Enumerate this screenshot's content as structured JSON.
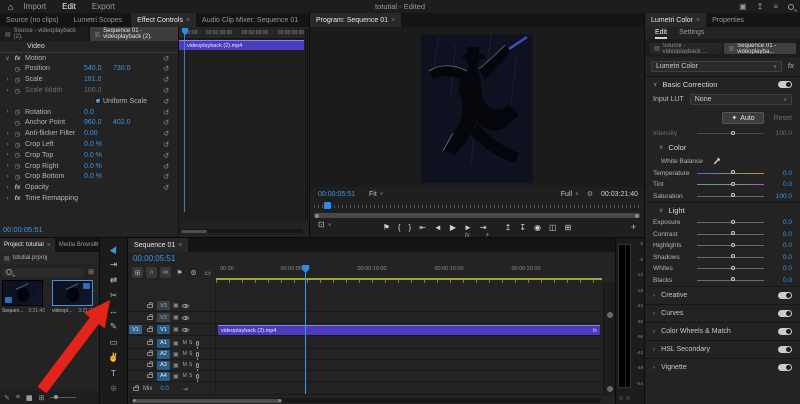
{
  "titlebar": {
    "home_icon": "⌂",
    "menus": [
      {
        "label": "Import"
      },
      {
        "label": "Edit",
        "cls": "active"
      },
      {
        "label": "Export"
      }
    ],
    "title": "totutial - Edited",
    "right_icons": [
      {
        "name": "workspace-icon",
        "glyph": "▣"
      },
      {
        "name": "export-icon",
        "glyph": "↥"
      },
      {
        "name": "stack-icon",
        "glyph": "≡"
      }
    ]
  },
  "effect_controls": {
    "tabs": [
      {
        "label": "Source (no clips)"
      },
      {
        "label": "Lumetri Scopes"
      },
      {
        "label": "Effect Controls",
        "cls": "active",
        "close": "×"
      },
      {
        "label": "Audio Clip Mixer: Sequence 01"
      }
    ],
    "clip_tabs": [
      {
        "icon": "▤",
        "label": "Source - videoplayback (2)."
      },
      {
        "icon": "▥",
        "label": "Sequence 01 - videoplayback (2).",
        "cls": "active"
      }
    ],
    "rows": [
      {
        "label": "Video",
        "cls": "hdr"
      },
      {
        "chev": "∨",
        "icon": "fx",
        "label": "Motion",
        "reset": "↺",
        "cls": "fxr"
      },
      {
        "icon": "◷",
        "label": "Position",
        "v1": "540.0",
        "v2": "730.0",
        "reset": "↺"
      },
      {
        "chev": "›",
        "icon": "◷",
        "label": "Scale",
        "v1": "181.0",
        "reset": "↺"
      },
      {
        "chev": "›",
        "icon": "◷",
        "label": "Scale Width",
        "v1": "100.0",
        "reset": "↺",
        "cls": "dim"
      },
      {
        "label": "Uniform Scale",
        "cls": "chk",
        "reset": "↺"
      },
      {
        "chev": "›",
        "icon": "◷",
        "label": "Rotation",
        "v1": "0.0",
        "reset": "↺"
      },
      {
        "icon": "◷",
        "label": "Anchor Point",
        "v1": "960.0",
        "v2": "402.0",
        "reset": "↺"
      },
      {
        "chev": "›",
        "icon": "◷",
        "label": "Anti-flicker Filter",
        "v1": "0.00",
        "reset": "↺"
      },
      {
        "chev": "›",
        "icon": "◷",
        "label": "Crop Left",
        "v1": "0.0 %",
        "reset": "↺"
      },
      {
        "chev": "›",
        "icon": "◷",
        "label": "Crop Top",
        "v1": "0.0 %",
        "reset": "↺"
      },
      {
        "chev": "›",
        "icon": "◷",
        "label": "Crop Right",
        "v1": "0.0 %",
        "reset": "↺"
      },
      {
        "chev": "›",
        "icon": "◷",
        "label": "Crop Bottom",
        "v1": "0.0 %",
        "reset": "↺"
      },
      {
        "chev": "›",
        "icon": "fx",
        "label": "Opacity",
        "reset": "↺",
        "cls": "fxr"
      },
      {
        "chev": "›",
        "icon": "fx",
        "label": "Time Remapping",
        "cls": "fxr"
      }
    ],
    "timecode": "00:00:05:51",
    "mini_timeline": {
      "ruler": [
        {
          "t": "00:00"
        },
        {
          "t": "00:01:00:00"
        },
        {
          "t": "00:02:00:00"
        },
        {
          "t": "00:03:00:00"
        }
      ],
      "clip": "videoplayback (2).mp4"
    }
  },
  "program": {
    "tab": "Program: Sequence 01",
    "tab_close": "×",
    "timecode": "00:00:05:51",
    "zoom_level": "Fit",
    "chevron": "∨",
    "playback_resolution": "Full",
    "wrench_glyph": "⚙",
    "duration": "00:03:21:40",
    "view_dropdown_glyph": "⊡",
    "transport": [
      {
        "name": "add-marker-icon",
        "glyph": "⚑"
      },
      {
        "name": "mark-in-icon",
        "glyph": "{"
      },
      {
        "name": "mark-out-icon",
        "glyph": "}"
      },
      {
        "name": "go-to-in-icon",
        "glyph": "⇤"
      },
      {
        "name": "step-back-icon",
        "glyph": "◄"
      },
      {
        "name": "play-icon",
        "glyph": "▶"
      },
      {
        "name": "step-forward-icon",
        "glyph": "►"
      },
      {
        "name": "go-to-out-icon",
        "glyph": "⇥"
      }
    ],
    "right_controls": [
      {
        "name": "lift-icon",
        "glyph": "↥"
      },
      {
        "name": "extract-icon",
        "glyph": "↧"
      },
      {
        "name": "export-frame-icon",
        "glyph": "◉"
      },
      {
        "name": "comparison-view-icon",
        "glyph": "◫"
      },
      {
        "name": "multi-camera-icon",
        "glyph": "⊞"
      }
    ],
    "sub_controls": [
      {
        "name": "fx-badge-icon",
        "glyph": "fx"
      },
      {
        "name": "export-media-icon",
        "glyph": "↥"
      }
    ],
    "add_button": "+"
  },
  "lumetri": {
    "tabs": [
      {
        "label": "Lumetri Color",
        "cls": "active",
        "close": "×"
      },
      {
        "label": "Properties"
      }
    ],
    "subtabs": [
      {
        "label": "Edit",
        "cls": "active"
      },
      {
        "label": "Settings"
      }
    ],
    "clip_tabs": [
      {
        "icon": "▤",
        "label": "Source - videoplayback ..."
      },
      {
        "icon": "▥",
        "label": "Sequence 01 - videoplayba...",
        "cls": "active"
      }
    ],
    "effect_name": "Lumetri Color",
    "chev_open": "∨",
    "fx_badge": "fx",
    "basic_section": "Basic Correction",
    "input_lut_label": "Input LUT",
    "input_lut_value": "None",
    "auto_icon": "✦",
    "auto_label": "Auto",
    "reset_label": "Reset",
    "intensity": {
      "label": "Intensity",
      "value": "100.0"
    },
    "color_header": "Color",
    "white_balance_label": "White Balance",
    "color_sliders": [
      {
        "label": "Temperature",
        "value": "0.0",
        "cls": "temp"
      },
      {
        "label": "Tint",
        "value": "0.0",
        "cls": "tint"
      },
      {
        "label": "Saturation",
        "value": "100.0"
      }
    ],
    "light_header": "Light",
    "light_sliders": [
      {
        "label": "Exposure",
        "value": "0.0"
      },
      {
        "label": "Contrast",
        "value": "0.0"
      },
      {
        "label": "Highlights",
        "value": "0.0"
      },
      {
        "label": "Shadows",
        "value": "0.0"
      },
      {
        "label": "Whites",
        "value": "0.0"
      },
      {
        "label": "Blacks",
        "value": "0.0"
      }
    ],
    "sections": [
      {
        "chev": "›",
        "label": "Creative"
      },
      {
        "chev": "›",
        "label": "Curves"
      },
      {
        "chev": "›",
        "label": "Color Wheels & Match"
      },
      {
        "chev": "›",
        "label": "HSL Secondary"
      },
      {
        "chev": "›",
        "label": "Vignette"
      }
    ]
  },
  "project": {
    "tabs": [
      {
        "label": "Project: totutial",
        "cls": "active",
        "close": "×"
      },
      {
        "label": "Media Browser"
      }
    ],
    "overflow_icon": "»",
    "folder_icon": "▤",
    "bin_icon": "⊞",
    "breadcrumb": "totutial.prproj",
    "items": [
      {
        "name": "Sequen...",
        "duration": "3:21:40"
      },
      {
        "name": "videopl...",
        "duration": "3:21:39",
        "cls": "selected"
      }
    ],
    "footer_icons": [
      {
        "name": "writable-pencil-icon",
        "glyph": "✎",
        "cls": "green"
      },
      {
        "name": "list-view-icon",
        "glyph": "≡"
      },
      {
        "name": "icon-view-icon",
        "glyph": "▦",
        "cls": "active"
      },
      {
        "name": "sort-icons-icon",
        "glyph": "⊞"
      }
    ]
  },
  "tools": [
    {
      "name": "selection-tool",
      "glyph": "▶",
      "cls": "active sel"
    },
    {
      "name": "track-select-forward-tool",
      "glyph": "⇥"
    },
    {
      "name": "ripple-edit-tool",
      "glyph": "⇄"
    },
    {
      "name": "razor-tool",
      "glyph": "✂"
    },
    {
      "name": "slip-tool",
      "glyph": "↔"
    },
    {
      "name": "pen-tool",
      "glyph": "✎"
    },
    {
      "name": "rectangle-tool",
      "glyph": "▭"
    },
    {
      "name": "hand-tool",
      "glyph": "✌"
    },
    {
      "name": "type-tool",
      "glyph": "T"
    },
    {
      "name": "zoom-tool",
      "glyph": "⊕",
      "cls": "dim"
    }
  ],
  "timeline": {
    "tab": "Sequence 01",
    "tab_close": "×",
    "timecode": "00:00:05:51",
    "toolbar": [
      {
        "name": "nest-icon",
        "glyph": "⊞",
        "cls": "btn"
      },
      {
        "name": "snap-icon",
        "glyph": "∩",
        "cls": "btn"
      },
      {
        "name": "linked-selection-icon",
        "glyph": "∞",
        "cls": "btn"
      },
      {
        "name": "add-marker-icon",
        "glyph": "⚑"
      },
      {
        "name": "timeline-settings-icon",
        "glyph": "⚙"
      },
      {
        "name": "captions-icon",
        "glyph": "▭"
      }
    ],
    "ruler": [
      {
        "t": "00:00"
      },
      {
        "t": "00:00:05:00"
      },
      {
        "t": "00:00:10:00"
      },
      {
        "t": "00:00:15:00"
      },
      {
        "t": "00:00:20:00"
      }
    ],
    "video_tracks": [
      {
        "name": "V3"
      },
      {
        "name": "V2"
      },
      {
        "name": "V1",
        "patch": "V1",
        "cls": "on"
      }
    ],
    "audio_tracks": [
      {
        "name": "A1",
        "mute": "M",
        "solo": "S",
        "cls": "on"
      },
      {
        "name": "A2",
        "mute": "M",
        "solo": "S",
        "cls": "on"
      },
      {
        "name": "A3",
        "mute": "M",
        "solo": "S",
        "cls": "on"
      },
      {
        "name": "A4",
        "mute": "M",
        "solo": "S",
        "cls": "on"
      }
    ],
    "clip": {
      "name": "videoplayback (2).mp4",
      "badge": "fx"
    },
    "mix": {
      "label": "Mix",
      "value": "0.0"
    }
  },
  "audio_meter": {
    "scale": [
      {
        "db": "0"
      },
      {
        "db": "-6"
      },
      {
        "db": "-12"
      },
      {
        "db": "-18"
      },
      {
        "db": "-24"
      },
      {
        "db": "-30"
      },
      {
        "db": "-36"
      },
      {
        "db": "-42"
      },
      {
        "db": "-48"
      },
      {
        "db": "-54"
      }
    ]
  },
  "annotation": {
    "shape": "arrow",
    "color": "#e3241b",
    "points_at": "razor-tool"
  }
}
